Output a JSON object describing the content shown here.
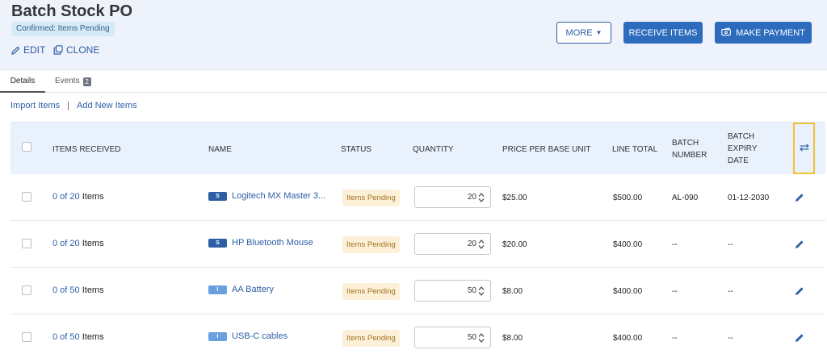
{
  "header": {
    "title": "Batch Stock PO",
    "status": "Confirmed: Items Pending",
    "edit_label": "EDIT",
    "clone_label": "CLONE",
    "more_label": "MORE",
    "receive_label": "RECEIVE ITEMS",
    "payment_label": "MAKE PAYMENT"
  },
  "tabs": {
    "details": "Details",
    "events": "Events",
    "events_count": "2"
  },
  "actions": {
    "import_label": "Import Items",
    "separator": "|",
    "add_label": "Add New Items"
  },
  "table": {
    "columns": {
      "items_received": "ITEMS RECEIVED",
      "name": "NAME",
      "status": "STATUS",
      "quantity": "QUANTITY",
      "price": "PRICE PER BASE UNIT",
      "line_total": "LINE TOTAL",
      "batch_number": "BATCH NUMBER",
      "batch_expiry": "BATCH EXPIRY DATE"
    },
    "items_suffix": "Items",
    "rows": [
      {
        "received": "0 of 20",
        "type": "S",
        "type_color": "#2d5fa6",
        "name": "Logitech MX Master 3...",
        "status": "Items Pending",
        "quantity": "20",
        "price": "$25.00",
        "line_total": "$500.00",
        "batch_number": "AL-090",
        "batch_expiry": "01-12-2030"
      },
      {
        "received": "0 of 20",
        "type": "S",
        "type_color": "#2d5fa6",
        "name": "HP Bluetooth Mouse",
        "status": "Items Pending",
        "quantity": "20",
        "price": "$20.00",
        "line_total": "$400.00",
        "batch_number": "--",
        "batch_expiry": "--"
      },
      {
        "received": "0 of 50",
        "type": "I",
        "type_color": "#6ba0e0",
        "name": "AA Battery",
        "status": "Items Pending",
        "quantity": "50",
        "price": "$8.00",
        "line_total": "$400.00",
        "batch_number": "--",
        "batch_expiry": "--"
      },
      {
        "received": "0 of 50",
        "type": "I",
        "type_color": "#6ba0e0",
        "name": "USB-C cables",
        "status": "Items Pending",
        "quantity": "50",
        "price": "$8.00",
        "line_total": "$400.00",
        "batch_number": "--",
        "batch_expiry": "--"
      }
    ]
  },
  "colors": {
    "accent": "#2d6bbd",
    "link": "#2d5fa6",
    "header_bg": "#eef2fa",
    "table_header_bg": "#e9f1fc",
    "pending_bg": "#fdf0d8",
    "pending_text": "#a27221",
    "highlight_border": "#f1c232"
  },
  "icons": {
    "edit": "pencil-icon",
    "clone": "copy-icon",
    "payment": "money-icon",
    "column_settings": "sliders-icon",
    "row_edit": "pencil-icon"
  }
}
